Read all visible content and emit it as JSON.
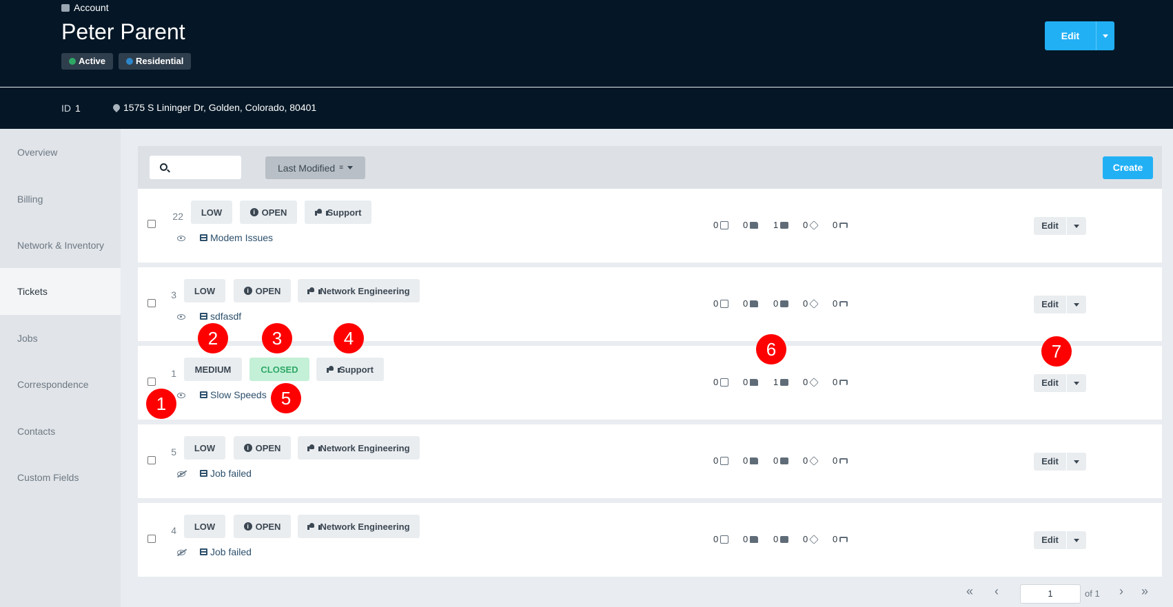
{
  "header": {
    "crumb": "Account",
    "title": "Peter Parent",
    "badges": [
      {
        "label": "Active",
        "color": "#2ea765"
      },
      {
        "label": "Residential",
        "color": "#2d86c9"
      }
    ],
    "edit_label": "Edit",
    "id_label": "ID",
    "id_value": "1",
    "address": "1575 S Lininger Dr, Golden, Colorado, 80401"
  },
  "sidebar": {
    "items": [
      "Overview",
      "Billing",
      "Network & Inventory",
      "Tickets",
      "Jobs",
      "Correspondence",
      "Contacts",
      "Custom Fields"
    ],
    "active": "Tickets"
  },
  "toolbar": {
    "search_value": "",
    "sort_label": "Last Modified",
    "create_label": "Create"
  },
  "tickets": [
    {
      "id": "22",
      "priority": "LOW",
      "status": "OPEN",
      "group": "Support",
      "name": "Modem Issues",
      "watched": true,
      "stats": [
        "0",
        "0",
        "1",
        "0",
        "0"
      ],
      "edit": "Edit"
    },
    {
      "id": "3",
      "priority": "LOW",
      "status": "OPEN",
      "group": "Network Engineering",
      "name": "sdfasdf",
      "watched": true,
      "stats": [
        "0",
        "0",
        "0",
        "0",
        "0"
      ],
      "edit": "Edit"
    },
    {
      "id": "1",
      "priority": "MEDIUM",
      "status": "CLOSED",
      "group": "Support",
      "name": "Slow Speeds",
      "watched": true,
      "stats": [
        "0",
        "0",
        "1",
        "0",
        "0"
      ],
      "edit": "Edit"
    },
    {
      "id": "5",
      "priority": "LOW",
      "status": "OPEN",
      "group": "Network Engineering",
      "name": "Job failed",
      "watched": false,
      "stats": [
        "0",
        "0",
        "0",
        "0",
        "0"
      ],
      "edit": "Edit"
    },
    {
      "id": "4",
      "priority": "LOW",
      "status": "OPEN",
      "group": "Network Engineering",
      "name": "Job failed",
      "watched": false,
      "stats": [
        "0",
        "0",
        "0",
        "0",
        "0"
      ],
      "edit": "Edit"
    }
  ],
  "markers": [
    "1",
    "2",
    "3",
    "4",
    "5",
    "6",
    "7"
  ],
  "pagination": {
    "page": "1",
    "of_label": "of 1"
  },
  "icons": [
    "search-icon",
    "info-icon",
    "group-icon",
    "eye-icon",
    "eye-slash-icon",
    "ticket-icon",
    "task-icon",
    "folder-icon",
    "briefcase-icon",
    "box-icon",
    "fork-icon",
    "chevron-down-icon"
  ]
}
